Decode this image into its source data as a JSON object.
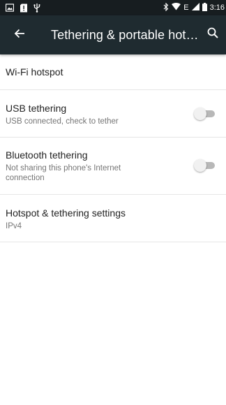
{
  "status_bar": {
    "time": "3:16",
    "left_icons": [
      "image-notification-icon",
      "alert-notification-icon",
      "usb-icon"
    ],
    "right_icons": [
      "bluetooth-icon",
      "wifi-icon",
      "data-e-icon",
      "signal-icon",
      "battery-icon"
    ],
    "network_type": "E"
  },
  "app_bar": {
    "title": "Tethering & portable hotspot",
    "background": "#1f2b30"
  },
  "items": [
    {
      "title": "Wi-Fi hotspot",
      "subtitle": ""
    },
    {
      "title": "USB tethering",
      "subtitle": "USB connected, check to tether",
      "toggle_on": false
    },
    {
      "title": "Bluetooth tethering",
      "subtitle": "Not sharing this phone's Internet connection",
      "toggle_on": false
    },
    {
      "title": "Hotspot & tethering settings",
      "subtitle": "IPv4"
    }
  ]
}
